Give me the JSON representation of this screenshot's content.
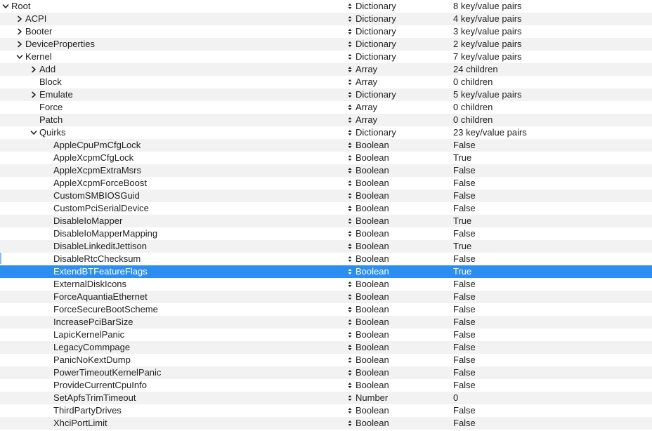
{
  "rows": [
    {
      "key": "Root",
      "depth": 0,
      "disclosure": "open",
      "type": "Dictionary",
      "value": "8 key/value pairs"
    },
    {
      "key": "ACPI",
      "depth": 1,
      "disclosure": "closed",
      "type": "Dictionary",
      "value": "4 key/value pairs"
    },
    {
      "key": "Booter",
      "depth": 1,
      "disclosure": "closed",
      "type": "Dictionary",
      "value": "3 key/value pairs"
    },
    {
      "key": "DeviceProperties",
      "depth": 1,
      "disclosure": "closed",
      "type": "Dictionary",
      "value": "2 key/value pairs"
    },
    {
      "key": "Kernel",
      "depth": 1,
      "disclosure": "open",
      "type": "Dictionary",
      "value": "7 key/value pairs"
    },
    {
      "key": "Add",
      "depth": 2,
      "disclosure": "closed",
      "type": "Array",
      "value": "24 children"
    },
    {
      "key": "Block",
      "depth": 2,
      "disclosure": "none",
      "type": "Array",
      "value": "0 children"
    },
    {
      "key": "Emulate",
      "depth": 2,
      "disclosure": "closed",
      "type": "Dictionary",
      "value": "5 key/value pairs"
    },
    {
      "key": "Force",
      "depth": 2,
      "disclosure": "none",
      "type": "Array",
      "value": "0 children"
    },
    {
      "key": "Patch",
      "depth": 2,
      "disclosure": "none",
      "type": "Array",
      "value": "0 children"
    },
    {
      "key": "Quirks",
      "depth": 2,
      "disclosure": "open",
      "type": "Dictionary",
      "value": "23 key/value pairs"
    },
    {
      "key": "AppleCpuPmCfgLock",
      "depth": 3,
      "disclosure": "none",
      "type": "Boolean",
      "value": "False"
    },
    {
      "key": "AppleXcpmCfgLock",
      "depth": 3,
      "disclosure": "none",
      "type": "Boolean",
      "value": "True"
    },
    {
      "key": "AppleXcpmExtraMsrs",
      "depth": 3,
      "disclosure": "none",
      "type": "Boolean",
      "value": "False"
    },
    {
      "key": "AppleXcpmForceBoost",
      "depth": 3,
      "disclosure": "none",
      "type": "Boolean",
      "value": "False"
    },
    {
      "key": "CustomSMBIOSGuid",
      "depth": 3,
      "disclosure": "none",
      "type": "Boolean",
      "value": "False"
    },
    {
      "key": "CustomPciSerialDevice",
      "depth": 3,
      "disclosure": "none",
      "type": "Boolean",
      "value": "False"
    },
    {
      "key": "DisableIoMapper",
      "depth": 3,
      "disclosure": "none",
      "type": "Boolean",
      "value": "True"
    },
    {
      "key": "DisableIoMapperMapping",
      "depth": 3,
      "disclosure": "none",
      "type": "Boolean",
      "value": "False"
    },
    {
      "key": "DisableLinkeditJettison",
      "depth": 3,
      "disclosure": "none",
      "type": "Boolean",
      "value": "True"
    },
    {
      "key": "DisableRtcChecksum",
      "depth": 3,
      "disclosure": "none",
      "type": "Boolean",
      "value": "False"
    },
    {
      "key": "ExtendBTFeatureFlags",
      "depth": 3,
      "disclosure": "none",
      "type": "Boolean",
      "value": "True",
      "selected": true
    },
    {
      "key": "ExternalDiskIcons",
      "depth": 3,
      "disclosure": "none",
      "type": "Boolean",
      "value": "False"
    },
    {
      "key": "ForceAquantiaEthernet",
      "depth": 3,
      "disclosure": "none",
      "type": "Boolean",
      "value": "False"
    },
    {
      "key": "ForceSecureBootScheme",
      "depth": 3,
      "disclosure": "none",
      "type": "Boolean",
      "value": "False"
    },
    {
      "key": "IncreasePciBarSize",
      "depth": 3,
      "disclosure": "none",
      "type": "Boolean",
      "value": "False"
    },
    {
      "key": "LapicKernelPanic",
      "depth": 3,
      "disclosure": "none",
      "type": "Boolean",
      "value": "False"
    },
    {
      "key": "LegacyCommpage",
      "depth": 3,
      "disclosure": "none",
      "type": "Boolean",
      "value": "False"
    },
    {
      "key": "PanicNoKextDump",
      "depth": 3,
      "disclosure": "none",
      "type": "Boolean",
      "value": "False"
    },
    {
      "key": "PowerTimeoutKernelPanic",
      "depth": 3,
      "disclosure": "none",
      "type": "Boolean",
      "value": "False"
    },
    {
      "key": "ProvideCurrentCpuInfo",
      "depth": 3,
      "disclosure": "none",
      "type": "Boolean",
      "value": "False"
    },
    {
      "key": "SetApfsTrimTimeout",
      "depth": 3,
      "disclosure": "none",
      "type": "Number",
      "value": "0"
    },
    {
      "key": "ThirdPartyDrives",
      "depth": 3,
      "disclosure": "none",
      "type": "Boolean",
      "value": "False"
    },
    {
      "key": "XhciPortLimit",
      "depth": 3,
      "disclosure": "none",
      "type": "Boolean",
      "value": "False"
    }
  ],
  "colors": {
    "selection": "#2b8ef0",
    "alternate_row": "#f2f2f2",
    "text": "#222222"
  },
  "icons": {
    "disclosure_open": "chevron-down-icon",
    "disclosure_closed": "chevron-right-icon",
    "type_stepper": "up-down-stepper-icon"
  }
}
